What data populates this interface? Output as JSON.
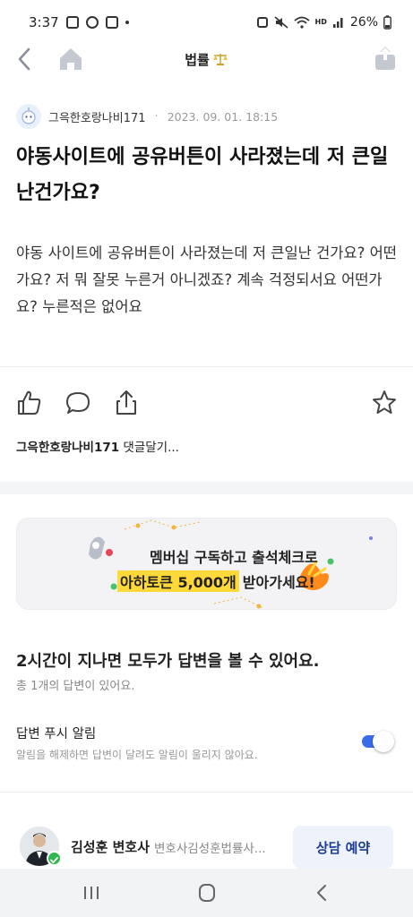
{
  "status_bar": {
    "time": "3:37",
    "battery": "26%",
    "network_label": "HD"
  },
  "app_bar": {
    "title": "법률",
    "title_icon": "scales-icon"
  },
  "post": {
    "author": "그윽한호랑나비171",
    "date": "2023. 09. 01. 18:15",
    "title": "야동사이트에 공유버튼이 사라졌는데 저 큰일난건가요?",
    "body": "야동 사이트에 공유버튼이 사라졌는데 저 큰일난 건가요? 어떤가요? 저 뭐 잘못 누른거 아니겠죠? 계속 걱정되서요 어떤가요? 누른적은 없어요"
  },
  "comment": {
    "user": "그윽한호랑나비171",
    "prompt": "댓글달기..."
  },
  "banner": {
    "line1": "멤버십 구독하고 출석체크로",
    "highlight": "아하토큰 5,000개",
    "line2_suffix": "받아가세요!"
  },
  "answers": {
    "title": "2시간이 지나면 모두가 답변을 볼 수 있어요.",
    "count": "총 1개의 답변이 있어요."
  },
  "push": {
    "title": "답변 푸시 알림",
    "desc": "알림을 해제하면 답변이 달려도 알림이 울리지 않아요.",
    "enabled": true
  },
  "lawyer": {
    "name": "김성훈 변호사",
    "subtitle": "변호사김성훈법률사...",
    "button": "상담 예약"
  },
  "colors": {
    "accent": "#3a6ee8",
    "highlight": "#ffd83a",
    "verified": "#2eb84f",
    "button_text": "#1b3d8f"
  }
}
